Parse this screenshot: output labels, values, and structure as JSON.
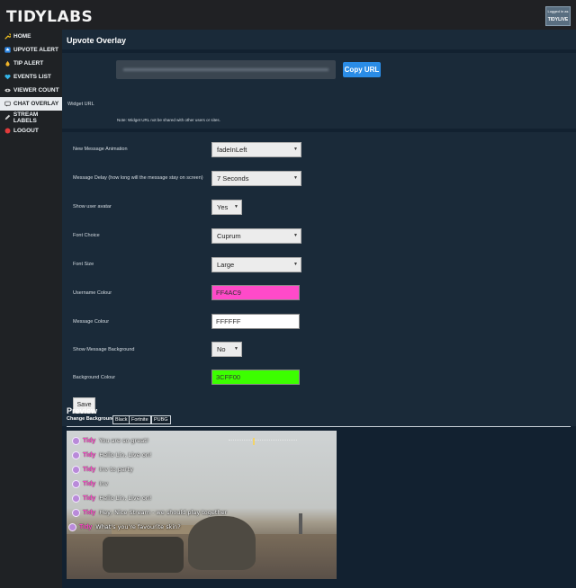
{
  "app": {
    "logo": "TIDYLABS"
  },
  "user": {
    "logged_in_label": "Logged in as",
    "username": "TIDYLIVE"
  },
  "sidebar": {
    "items": [
      {
        "label": "HOME",
        "icon": "wrench-icon",
        "color": "#f0c020"
      },
      {
        "label": "UPVOTE ALERT",
        "icon": "upvote-icon",
        "color": "#2f88e6"
      },
      {
        "label": "TIP ALERT",
        "icon": "coin-icon",
        "color": "#f0b429"
      },
      {
        "label": "EVENTS LIST",
        "icon": "heart-icon",
        "color": "#33b4e8"
      },
      {
        "label": "VIEWER COUNT",
        "icon": "eye-icon",
        "color": "#d0d0d0"
      },
      {
        "label": "CHAT OVERLAY",
        "icon": "chat-icon",
        "color": "#333333",
        "active": true
      },
      {
        "label": "STREAM LABELS",
        "icon": "pencil-icon",
        "color": "#d0d0d0"
      },
      {
        "label": "LOGOUT",
        "icon": "power-icon",
        "color": "#e23b3b"
      }
    ]
  },
  "header": {
    "title": "Upvote Overlay"
  },
  "widget": {
    "label": "Widget URL",
    "copy_label": "Copy URL",
    "note": "Note: Widget URL not be shared with other users or sites."
  },
  "settings": {
    "animation_label": "New Message Animation",
    "animation_value": "fadeInLeft",
    "delay_label": "Message Delay (how long will the message stay on screen)",
    "delay_value": "7 Seconds",
    "avatar_label": "Show user avatar",
    "avatar_value": "Yes",
    "font_label": "Font Choice",
    "font_value": "Cuprum",
    "size_label": "Font Size",
    "size_value": "Large",
    "username_colour_label": "Username Colour",
    "username_colour_value": "FF4AC9",
    "message_colour_label": "Message Colour",
    "message_colour_value": "FFFFFF",
    "show_bg_label": "Show Message Background",
    "show_bg_value": "No",
    "bg_colour_label": "Background Colour",
    "bg_colour_value": "3CFF00",
    "save_label": "Save"
  },
  "colors": {
    "username": "#FF4AC9",
    "message": "#FFFFFF",
    "background": "#3CFF00",
    "accent": "#2A8CE6"
  },
  "preview": {
    "title": "Preview",
    "change_bg_label": "Change Background:",
    "bg_options": [
      "Black",
      "Fortnite",
      "PUBG"
    ],
    "messages": [
      {
        "user": "Tidy",
        "text": "You are so great!"
      },
      {
        "user": "Tidy",
        "text": "Hello Lin, Live on!"
      },
      {
        "user": "Tidy",
        "text": "Inv to party"
      },
      {
        "user": "Tidy",
        "text": "Inv"
      },
      {
        "user": "Tidy",
        "text": "Hello Lin, Live on!"
      },
      {
        "user": "Tidy",
        "text": "Hey, Nice Stream - we should play together"
      },
      {
        "user": "Tidy",
        "text": "What's you're favourite skin?"
      }
    ]
  }
}
